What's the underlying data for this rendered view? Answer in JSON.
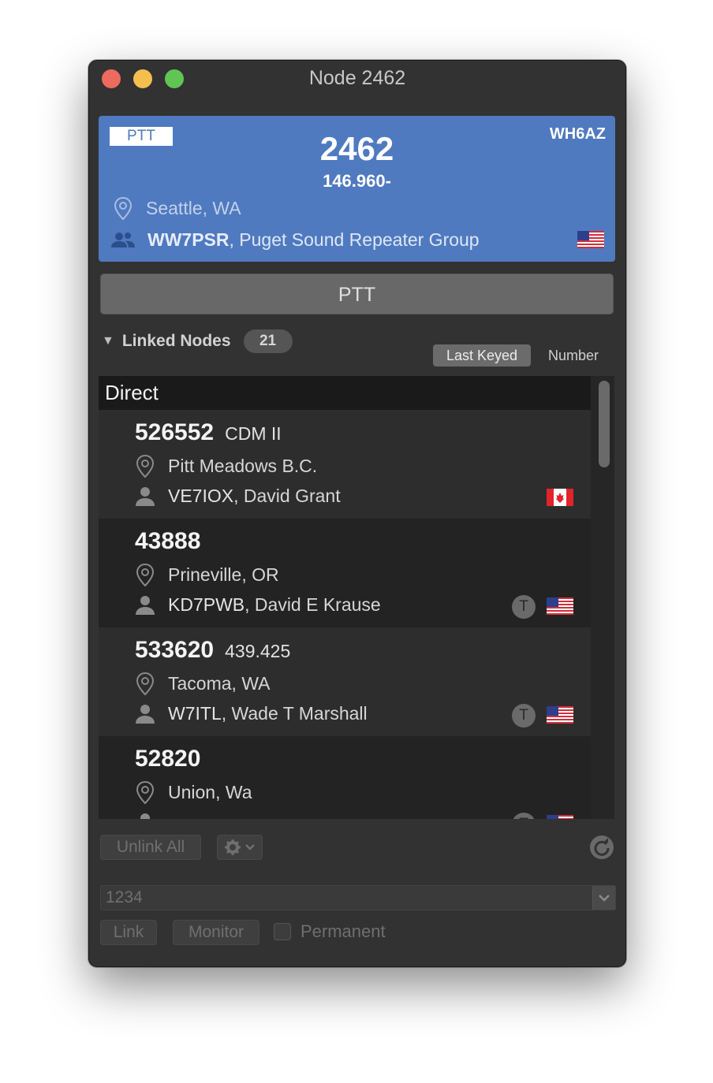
{
  "window": {
    "title": "Node 2462"
  },
  "node": {
    "ptt_badge": "PTT",
    "number": "2462",
    "frequency": "146.960-",
    "callsign": "WH6AZ",
    "location": "Seattle, WA",
    "owner_callsign": "WW7PSR",
    "owner_rest": ", Puget Sound Repeater Group",
    "flag": "us-flag-icon"
  },
  "ptt_button": "PTT",
  "linked": {
    "label": "Linked Nodes",
    "count": "21",
    "sort_options": [
      "Last Keyed",
      "Number"
    ],
    "section": "Direct",
    "rows": [
      {
        "number": "526552",
        "desc": "CDM II",
        "location": "Pitt Meadows B.C.",
        "owner_callsign": "VE7IOX",
        "owner_rest": ", David Grant",
        "badge": "",
        "flag": "ca-flag-icon"
      },
      {
        "number": "43888",
        "desc": "",
        "location": "Prineville, OR",
        "owner_callsign": "KD7PWB",
        "owner_rest": ", David E Krause",
        "badge": "T",
        "flag": "us-flag-icon"
      },
      {
        "number": "533620",
        "desc": "439.425",
        "location": "Tacoma, WA",
        "owner_callsign": "W7ITL",
        "owner_rest": ", Wade T Marshall",
        "badge": "T",
        "flag": "us-flag-icon"
      },
      {
        "number": "52820",
        "desc": "",
        "location": "Union, Wa",
        "owner_callsign": "",
        "owner_rest": "",
        "badge": "T",
        "flag": "us-flag-icon"
      }
    ]
  },
  "controls": {
    "unlink_all": "Unlink All",
    "node_input_value": "1234",
    "link": "Link",
    "monitor": "Monitor",
    "permanent": "Permanent"
  }
}
